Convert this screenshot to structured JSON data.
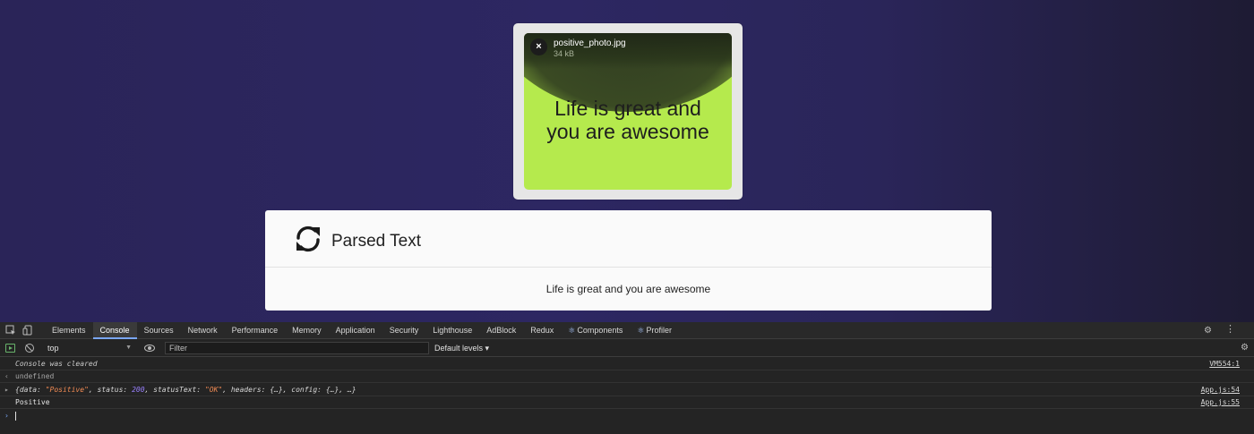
{
  "file_card": {
    "file_name": "positive_photo.jpg",
    "file_size": "34 kB",
    "close_glyph": "×",
    "preview_line1": "Life is great and",
    "preview_line2": "you are awesome",
    "preview_bg_color": "#b5ea4d"
  },
  "parsed": {
    "icon": "refresh-icon",
    "title": "Parsed Text",
    "result": "Life is great and you are awesome"
  },
  "devtools": {
    "tabs": [
      {
        "label": "Elements"
      },
      {
        "label": "Console",
        "active": true
      },
      {
        "label": "Sources"
      },
      {
        "label": "Network"
      },
      {
        "label": "Performance"
      },
      {
        "label": "Memory"
      },
      {
        "label": "Application"
      },
      {
        "label": "Security"
      },
      {
        "label": "Lighthouse"
      },
      {
        "label": "AdBlock"
      },
      {
        "label": "Redux"
      },
      {
        "label": "Components",
        "glyph": "⚛"
      },
      {
        "label": "Profiler",
        "glyph": "⚛"
      }
    ],
    "more_glyph": "⋮",
    "settings_glyph": "⚙",
    "toolbar": {
      "context": "top",
      "context_arrow": "▼",
      "filter_placeholder": "Filter",
      "levels": "Default levels ▾"
    },
    "console": {
      "cleared": {
        "text": "Console was cleared",
        "source": "VM554:1"
      },
      "undefined": {
        "prefix": "‹",
        "text": "undefined"
      },
      "response": {
        "prefix": "▸",
        "open": "{data: ",
        "data": "\"Positive\"",
        "status_label": ", status: ",
        "status": "200",
        "status_text_label": ", statusText: ",
        "status_text": "\"OK\"",
        "rest": ", headers: {…}, config: {…}, …}",
        "source": "App.js:54"
      },
      "positive": {
        "text": "Positive",
        "source": "App.js:55"
      },
      "prompt": "›"
    }
  }
}
